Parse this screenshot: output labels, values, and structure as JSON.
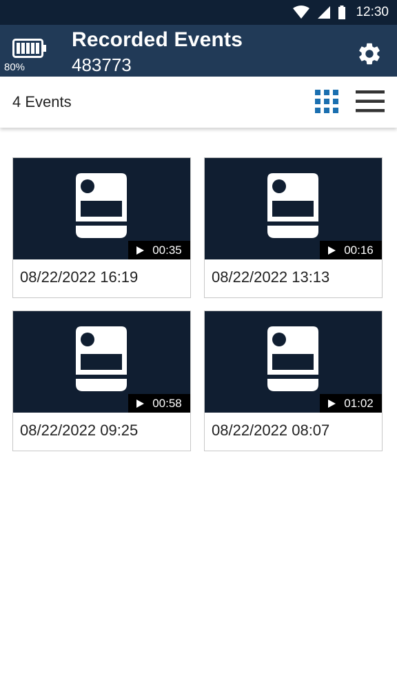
{
  "statusbar": {
    "time": "12:30",
    "icons": [
      "wifi-icon",
      "cell-signal-icon",
      "battery-status-icon"
    ]
  },
  "appbar": {
    "battery_percent": "80%",
    "title": "Recorded Events",
    "subtitle": "483773",
    "settings_icon": "gear-icon"
  },
  "toolbar": {
    "events_count": "4 Events",
    "grid_view_icon": "grid-icon",
    "list_view_icon": "list-icon",
    "active_view": "grid",
    "accent_color": "#1a6fb0"
  },
  "events": [
    {
      "duration": "00:35",
      "date": "08/22/2022 16:19"
    },
    {
      "duration": "00:16",
      "date": "08/22/2022 13:13"
    },
    {
      "duration": "00:58",
      "date": "08/22/2022 09:25"
    },
    {
      "duration": "01:02",
      "date": "08/22/2022 08:07"
    }
  ]
}
